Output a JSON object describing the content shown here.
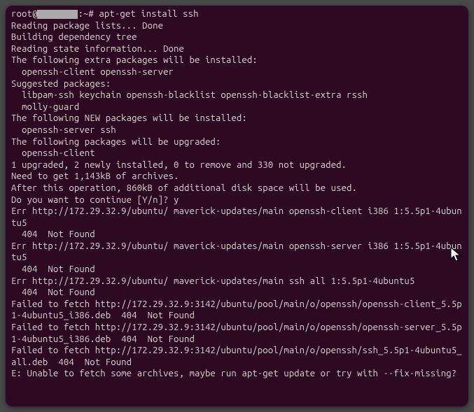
{
  "prompt": {
    "user": "root@",
    "tail": ":~# ",
    "command": "apt-get install ssh"
  },
  "lines": [
    "Reading package lists... Done",
    "Building dependency tree       ",
    "Reading state information... Done",
    "The following extra packages will be installed:",
    "  openssh-client openssh-server",
    "Suggested packages:",
    "  libpam-ssh keychain openssh-blacklist openssh-blacklist-extra rssh",
    "  molly-guard",
    "The following NEW packages will be installed:",
    "  openssh-server ssh",
    "The following packages will be upgraded:",
    "  openssh-client",
    "1 upgraded, 2 newly installed, 0 to remove and 330 not upgraded.",
    "Need to get 1,143kB of archives.",
    "After this operation, 860kB of additional disk space will be used.",
    "Do you want to continue [Y/n]? y",
    "Err http://172.29.32.9/ubuntu/ maverick-updates/main openssh-client i386 1:5.5p1-4ubuntu5",
    "  404  Not Found",
    "Err http://172.29.32.9/ubuntu/ maverick-updates/main openssh-server i386 1:5.5p1-4ubuntu5",
    "  404  Not Found",
    "Err http://172.29.32.9/ubuntu/ maverick-updates/main ssh all 1:5.5p1-4ubuntu5",
    "  404  Not Found",
    "Failed to fetch http://172.29.32.9:3142/ubuntu/pool/main/o/openssh/openssh-client_5.5p1-4ubuntu5_i386.deb  404  Not Found",
    "Failed to fetch http://172.29.32.9:3142/ubuntu/pool/main/o/openssh/openssh-server_5.5p1-4ubuntu5_i386.deb  404  Not Found",
    "Failed to fetch http://172.29.32.9:3142/ubuntu/pool/main/o/openssh/ssh_5.5p1-4ubuntu5_all.deb  404  Not Found",
    "E: Unable to fetch some archives, maybe run apt-get update or try with --fix-missing?"
  ]
}
